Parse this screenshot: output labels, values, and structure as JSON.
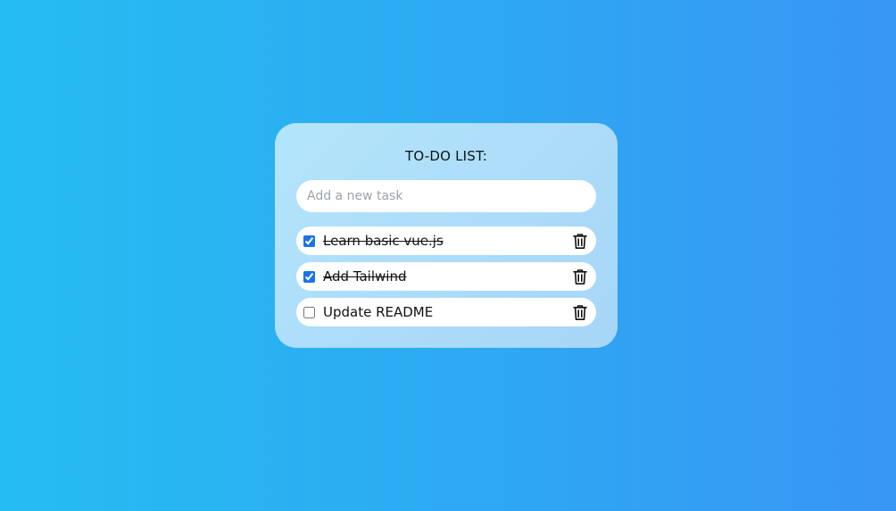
{
  "card": {
    "title": "TO-DO LIST:",
    "input_placeholder": "Add a new task"
  },
  "tasks": [
    {
      "label": "Learn basic vue.js",
      "done": true
    },
    {
      "label": "Add Tailwind",
      "done": true
    },
    {
      "label": "Update README",
      "done": false
    }
  ],
  "icons": {
    "delete": "trash-icon"
  },
  "colors": {
    "background_start": "#25bdf1",
    "background_end": "#3896f4",
    "card": "#b3e5fb",
    "checkbox_accent": "#1a73e8"
  }
}
